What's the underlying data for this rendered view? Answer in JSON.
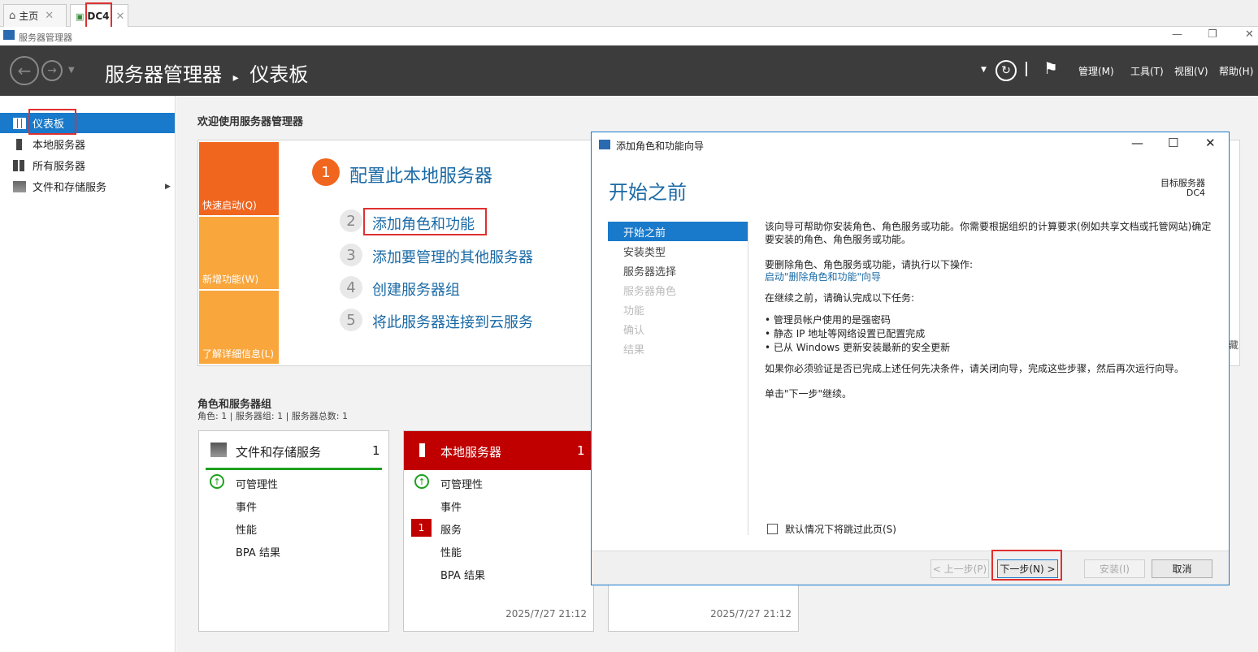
{
  "tabs": [
    {
      "label": "主页",
      "icon": "home-icon"
    },
    {
      "label": "DC4",
      "icon": "remote-desktop-icon"
    }
  ],
  "app": {
    "title": "服务器管理器"
  },
  "header": {
    "breadcrumb_root": "服务器管理器",
    "separator": "▸",
    "breadcrumb_page": "仪表板",
    "menus": [
      "管理(M)",
      "工具(T)",
      "视图(V)",
      "帮助(H)"
    ]
  },
  "leftnav": {
    "items": [
      {
        "label": "仪表板",
        "icon": "dashboard-icon",
        "selected": true
      },
      {
        "label": "本地服务器",
        "icon": "server-icon"
      },
      {
        "label": "所有服务器",
        "icon": "servers-icon"
      },
      {
        "label": "文件和存储服务",
        "icon": "file-storage-icon",
        "expandable": true
      }
    ]
  },
  "welcome": {
    "heading": "欢迎使用服务器管理器",
    "tiles": [
      "快速启动(Q)",
      "新增功能(W)",
      "了解详细信息(L)"
    ],
    "steps": [
      {
        "num": "1",
        "text": "配置此本地服务器"
      },
      {
        "num": "2",
        "text": "添加角色和功能"
      },
      {
        "num": "3",
        "text": "添加要管理的其他服务器"
      },
      {
        "num": "4",
        "text": "创建服务器组"
      },
      {
        "num": "5",
        "text": "将此服务器连接到云服务"
      }
    ],
    "right_edge_text": "藏"
  },
  "roles": {
    "heading": "角色和服务器组",
    "summary": "角色: 1 | 服务器组: 1 | 服务器总数: 1",
    "cards": [
      {
        "title": "文件和存储服务",
        "count": "1",
        "rows": [
          "可管理性",
          "事件",
          "性能",
          "BPA 结果"
        ],
        "timestamp": ""
      },
      {
        "title": "本地服务器",
        "count": "1",
        "rows": [
          "可管理性",
          "事件",
          "服务",
          "性能",
          "BPA 结果"
        ],
        "service_badge": "1",
        "timestamp": "2025/7/27 21:12"
      },
      {
        "title": "",
        "timestamp": "2025/7/27 21:12"
      }
    ]
  },
  "wizard": {
    "title": "添加角色和功能向导",
    "page_title": "开始之前",
    "target_label": "目标服务器",
    "target_value": "DC4",
    "nav": [
      {
        "label": "开始之前",
        "state": "selected"
      },
      {
        "label": "安装类型",
        "state": "enabled"
      },
      {
        "label": "服务器选择",
        "state": "enabled"
      },
      {
        "label": "服务器角色",
        "state": "disabled"
      },
      {
        "label": "功能",
        "state": "disabled"
      },
      {
        "label": "确认",
        "state": "disabled"
      },
      {
        "label": "结果",
        "state": "disabled"
      }
    ],
    "p1": "该向导可帮助你安装角色、角色服务或功能。你需要根据组织的计算要求(例如共享文档或托管网站)确定",
    "p1b": "要安装的角色、角色服务或功能。",
    "p2": "要删除角色、角色服务或功能，请执行以下操作:",
    "p2_link": "启动\"删除角色和功能\"向导",
    "p3": "在继续之前，请确认完成以下任务:",
    "bullets": [
      "管理员帐户使用的是强密码",
      "静态 IP 地址等网络设置已配置完成",
      "已从 Windows 更新安装最新的安全更新"
    ],
    "p4": "如果你必须验证是否已完成上述任何先决条件，请关闭向导，完成这些步骤，然后再次运行向导。",
    "p5": "单击\"下一步\"继续。",
    "skip_checkbox": "默认情况下将跳过此页(S)",
    "buttons": {
      "prev": "< 上一步(P)",
      "next": "下一步(N) >",
      "install": "安装(I)",
      "cancel": "取消"
    }
  },
  "colors": {
    "accent": "#1979ca",
    "header": "#3c3c3c",
    "quick_start": "#f0661f",
    "tile_orange": "#f9a63c",
    "alert_red": "#c00000",
    "ok_green": "#1ea01e"
  }
}
